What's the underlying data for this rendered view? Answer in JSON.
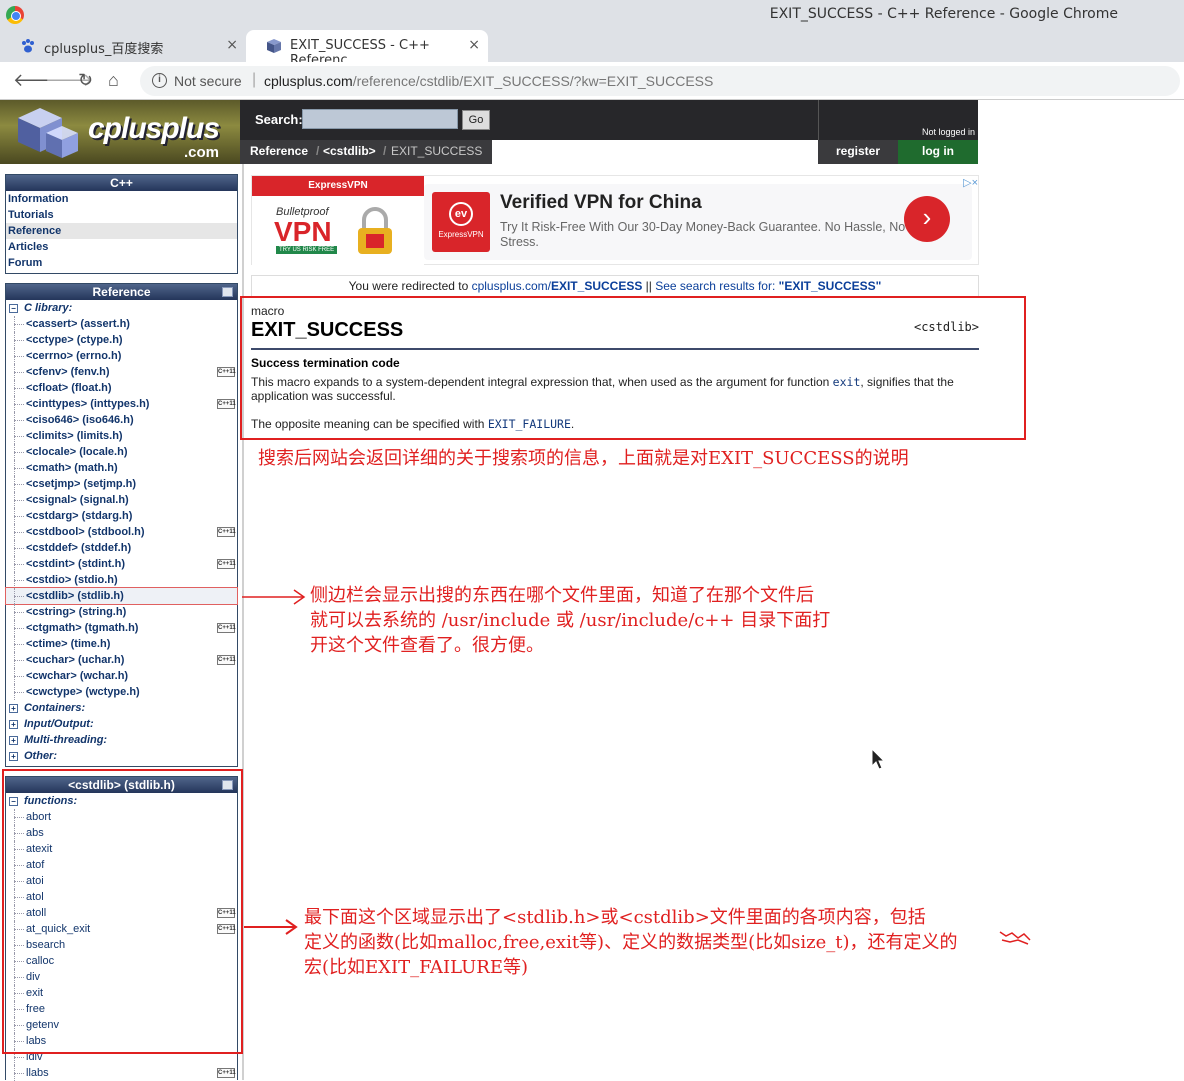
{
  "window": {
    "title": "EXIT_SUCCESS - C++ Reference - Google Chrome"
  },
  "tabs": [
    {
      "label": "cplusplus_百度搜索",
      "close": "×"
    },
    {
      "label": "EXIT_SUCCESS - C++ Referenc",
      "close": "×"
    }
  ],
  "new_tab": "+",
  "omnibox": {
    "security": "Not secure",
    "domain": "cplusplus.com",
    "path": "/reference/cstdlib/EXIT_SUCCESS/?kw=EXIT_SUCCESS"
  },
  "site": {
    "logo_text": "cplusplus",
    "logo_suffix": ".com",
    "search_label": "Search:",
    "search_value": "",
    "go_label": "Go",
    "breadcrumbs": [
      "Reference",
      "<cstdlib>",
      "EXIT_SUCCESS"
    ],
    "login_status": "Not logged in",
    "register_label": "register",
    "login_label": "log in"
  },
  "sidebar": {
    "cpp_title": "C++",
    "cpp_items": [
      "Information",
      "Tutorials",
      "Reference",
      "Articles",
      "Forum"
    ],
    "cpp_selected": "Reference",
    "reference_title": "Reference",
    "c_library_label": "C library:",
    "c_headers": [
      {
        "label": "<cassert> (assert.h)",
        "cpp11": false
      },
      {
        "label": "<cctype> (ctype.h)",
        "cpp11": false
      },
      {
        "label": "<cerrno> (errno.h)",
        "cpp11": false
      },
      {
        "label": "<cfenv> (fenv.h)",
        "cpp11": true
      },
      {
        "label": "<cfloat> (float.h)",
        "cpp11": false
      },
      {
        "label": "<cinttypes> (inttypes.h)",
        "cpp11": true
      },
      {
        "label": "<ciso646> (iso646.h)",
        "cpp11": false
      },
      {
        "label": "<climits> (limits.h)",
        "cpp11": false
      },
      {
        "label": "<clocale> (locale.h)",
        "cpp11": false
      },
      {
        "label": "<cmath> (math.h)",
        "cpp11": false
      },
      {
        "label": "<csetjmp> (setjmp.h)",
        "cpp11": false
      },
      {
        "label": "<csignal> (signal.h)",
        "cpp11": false
      },
      {
        "label": "<cstdarg> (stdarg.h)",
        "cpp11": false
      },
      {
        "label": "<cstdbool> (stdbool.h)",
        "cpp11": true
      },
      {
        "label": "<cstddef> (stddef.h)",
        "cpp11": false
      },
      {
        "label": "<cstdint> (stdint.h)",
        "cpp11": true
      },
      {
        "label": "<cstdio> (stdio.h)",
        "cpp11": false
      },
      {
        "label": "<cstdlib> (stdlib.h)",
        "cpp11": false,
        "highlighted": true
      },
      {
        "label": "<cstring> (string.h)",
        "cpp11": false
      },
      {
        "label": "<ctgmath> (tgmath.h)",
        "cpp11": true
      },
      {
        "label": "<ctime> (time.h)",
        "cpp11": false
      },
      {
        "label": "<cuchar> (uchar.h)",
        "cpp11": true
      },
      {
        "label": "<cwchar> (wchar.h)",
        "cpp11": false
      },
      {
        "label": "<cwctype> (wctype.h)",
        "cpp11": false
      }
    ],
    "other_categories": [
      "Containers:",
      "Input/Output:",
      "Multi-threading:",
      "Other:"
    ],
    "cstdlib_title": "<cstdlib> (stdlib.h)",
    "functions_label": "functions:",
    "functions": [
      {
        "label": "abort",
        "cpp11": false
      },
      {
        "label": "abs",
        "cpp11": false
      },
      {
        "label": "atexit",
        "cpp11": false
      },
      {
        "label": "atof",
        "cpp11": false
      },
      {
        "label": "atoi",
        "cpp11": false
      },
      {
        "label": "atol",
        "cpp11": false
      },
      {
        "label": "atoll",
        "cpp11": true
      },
      {
        "label": "at_quick_exit",
        "cpp11": true
      },
      {
        "label": "bsearch",
        "cpp11": false
      },
      {
        "label": "calloc",
        "cpp11": false
      },
      {
        "label": "div",
        "cpp11": false
      },
      {
        "label": "exit",
        "cpp11": false
      },
      {
        "label": "free",
        "cpp11": false
      },
      {
        "label": "getenv",
        "cpp11": false
      },
      {
        "label": "labs",
        "cpp11": false
      },
      {
        "label": "ldiv",
        "cpp11": false
      },
      {
        "label": "llabs",
        "cpp11": true
      }
    ],
    "cpp11_badge": "C++11"
  },
  "ad": {
    "brand": "ExpressVPN",
    "bulletproof": "Bulletproof",
    "vpn": "VPN",
    "try_us": "TRY US RISK FREE",
    "headline": "Verified VPN for China",
    "body": "Try It Risk-Free With Our 30-Day Money-Back Guarantee. No Hassle, No Stress.",
    "logo_caption": "ExpressVPN",
    "go_glyph": "›",
    "adchoices": "▷×"
  },
  "redirect": {
    "prefix": "You were redirected to ",
    "link_host": "cplusplus.com/",
    "link_name": "EXIT_SUCCESS",
    "separator": " || ",
    "search_prefix": "See search results for: ",
    "search_term": "\"EXIT_SUCCESS\""
  },
  "article": {
    "kind": "macro",
    "name": "EXIT_SUCCESS",
    "header": "<cstdlib>",
    "subtitle": "Success termination code",
    "desc_1": "This macro expands to a system-dependent integral expression that, when used as the argument for function ",
    "desc_1_code": "exit",
    "desc_1_end": ", signifies that the application was successful.",
    "desc_2": "The opposite meaning can be specified with ",
    "desc_2_code": "EXIT_FAILURE",
    "desc_2_end": "."
  },
  "annotations": {
    "a1": "搜索后网站会返回详细的关于搜索项的信息，上面就是对EXIT_SUCCESS的说明",
    "a2_l1": "侧边栏会显示出搜的东西在哪个文件里面，知道了在那个文件后",
    "a2_l2": "就可以去系统的 /usr/include 或 /usr/include/c++ 目录下面打",
    "a2_l3": "开这个文件查看了。很方便。",
    "a3_l1": "最下面这个区域显示出了<stdlib.h>或<cstdlib>文件里面的各项内容，包括",
    "a3_l2": "定义的函数(比如malloc,free,exit等)、定义的数据类型(比如size_t)，还有定义的",
    "a3_l3": "宏(比如EXIT_FAILURE等)",
    "color": "#e02020"
  }
}
